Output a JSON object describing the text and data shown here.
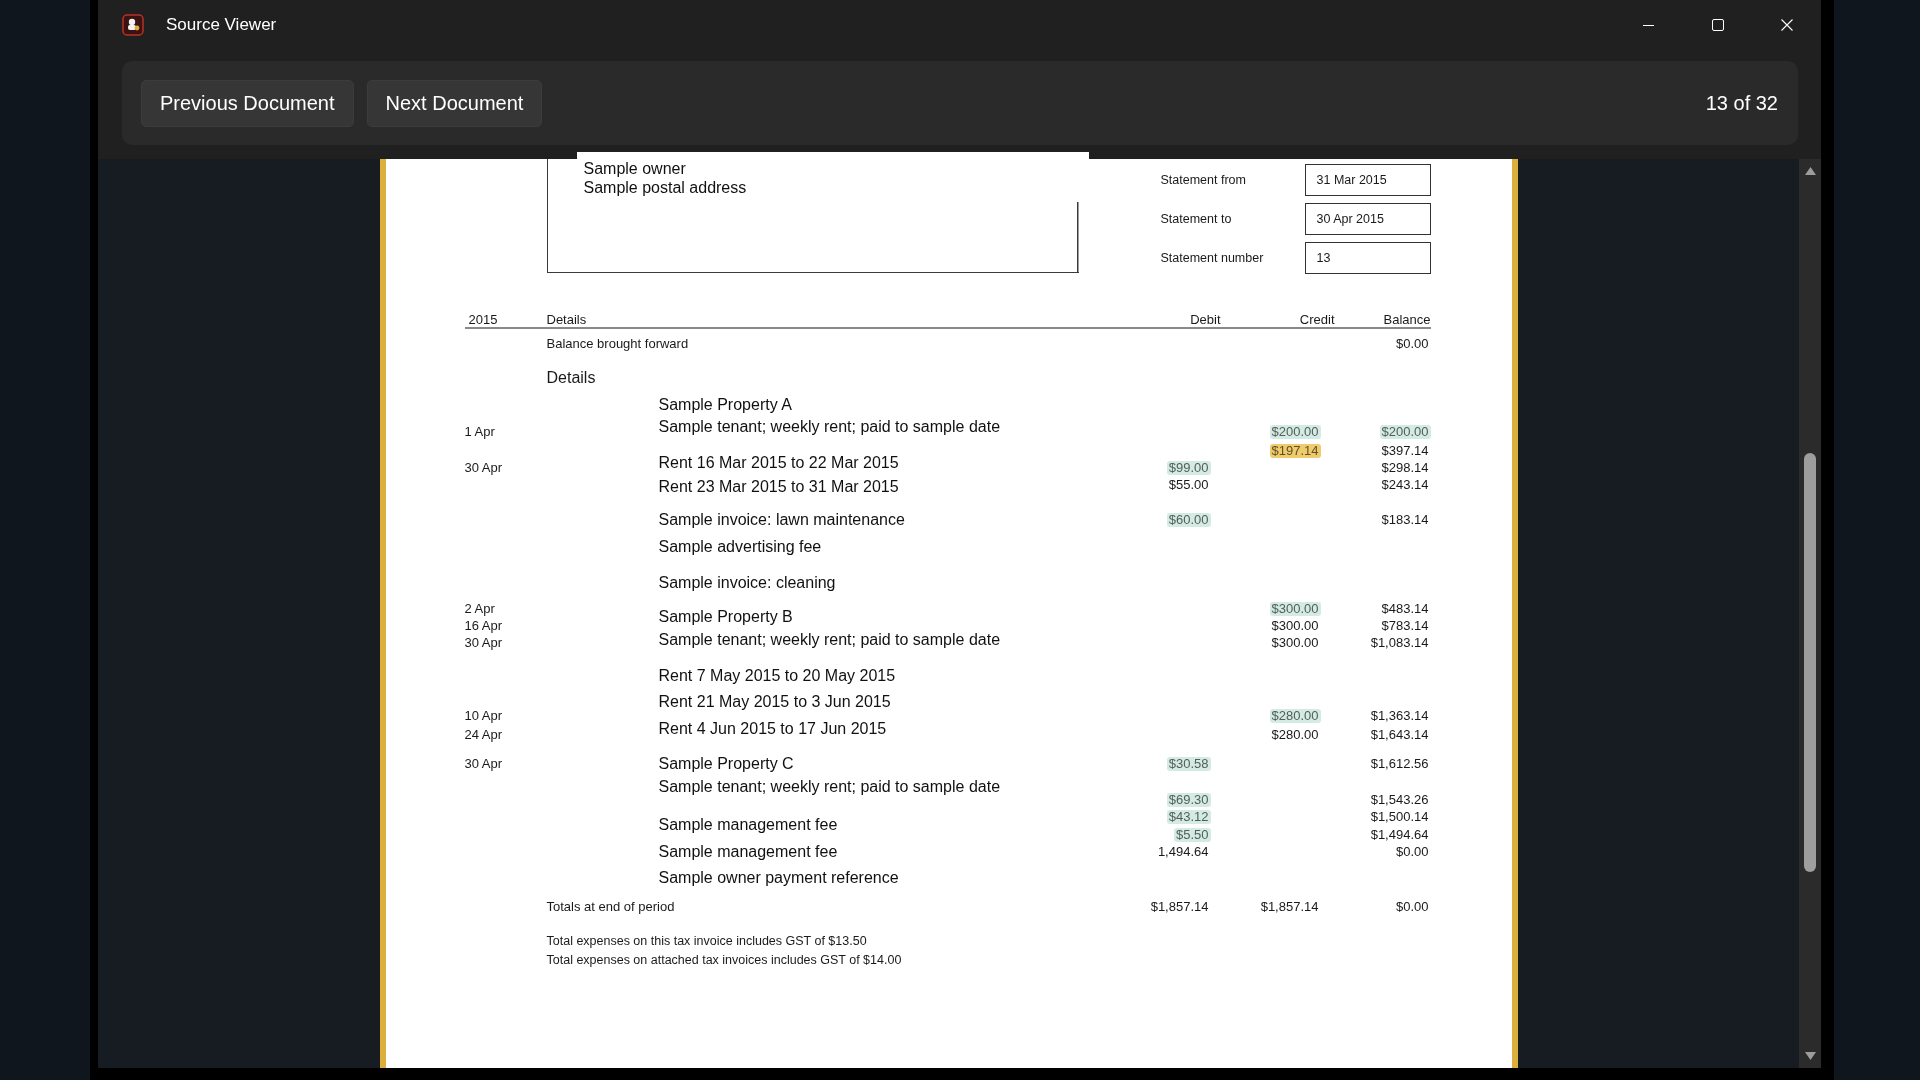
{
  "window": {
    "title": "Source Viewer"
  },
  "toolbar": {
    "buttons": [
      "Previous Document",
      "Next Document"
    ],
    "page_counter": "13 of 32"
  },
  "document": {
    "address_lines": [
      "Sample owner",
      "Sample postal address"
    ],
    "statement_fields": [
      {
        "label": "Statement from",
        "value": "31 Mar 2015"
      },
      {
        "label": "Statement to",
        "value": "30 Apr 2015"
      },
      {
        "label": "Statement number",
        "value": "13"
      }
    ],
    "table": {
      "columns": [
        "2015",
        "Details",
        "Debit",
        "Credit",
        "Balance"
      ],
      "opening_row": {
        "details": "Balance brought forward",
        "balance": "$0.00"
      },
      "section_heading": "Details",
      "descriptions": [
        "Sample Property A",
        "Sample tenant; weekly rent; paid to sample date",
        "Rent 16 Mar 2015 to 22 Mar 2015",
        "Rent 23 Mar 2015 to 31 Mar 2015",
        "Sample invoice: lawn maintenance",
        "Sample advertising fee",
        "Sample invoice: cleaning",
        "Sample Property B",
        "Sample tenant; weekly rent; paid to sample date",
        "Rent 7 May 2015 to 20 May 2015",
        "Rent 21 May 2015 to 3 Jun 2015",
        "Rent 4 Jun 2015 to 17 Jun 2015",
        "Sample Property C",
        "Sample tenant; weekly rent; paid to sample date",
        "Sample management fee",
        "Sample management fee",
        "Sample owner payment reference"
      ],
      "entries": [
        {
          "date": "1 Apr",
          "credit": {
            "text": "$200.00",
            "color": "#d3ebe2"
          },
          "balance": {
            "text": "$200.00",
            "color": "#d3ebe2"
          }
        },
        {
          "credit": {
            "text": "$197.14",
            "color": "#efcb6b"
          },
          "balance": {
            "text": "$397.14"
          }
        },
        {
          "date": "30 Apr",
          "debit": {
            "text": "$99.00",
            "color": "#d3ebe2"
          },
          "balance": {
            "text": "$298.14"
          }
        },
        {
          "debit": {
            "text": "$55.00"
          },
          "balance": {
            "text": "$243.14"
          }
        },
        {
          "debit": {
            "text": "$60.00",
            "color": "#d3ebe2"
          },
          "balance": {
            "text": "$183.14"
          }
        },
        {
          "date": "2 Apr",
          "credit": {
            "text": "$300.00",
            "color": "#d3ebe2"
          },
          "balance": {
            "text": "$483.14"
          }
        },
        {
          "date": "16 Apr",
          "credit": {
            "text": "$300.00"
          },
          "balance": {
            "text": "$783.14"
          }
        },
        {
          "date": "30 Apr",
          "credit": {
            "text": "$300.00"
          },
          "balance": {
            "text": "$1,083.14"
          }
        },
        {
          "date": "10 Apr",
          "credit": {
            "text": "$280.00",
            "color": "#d3ebe2"
          },
          "balance": {
            "text": "$1,363.14"
          }
        },
        {
          "date": "24 Apr",
          "credit": {
            "text": "$280.00"
          },
          "balance": {
            "text": "$1,643.14"
          }
        },
        {
          "date": "30 Apr",
          "debit": {
            "text": "$30.58",
            "color": "#d3ebe2"
          },
          "balance": {
            "text": "$1,612.56"
          }
        },
        {
          "debit": {
            "text": "$69.30",
            "color": "#d3ebe2"
          },
          "balance": {
            "text": "$1,543.26"
          }
        },
        {
          "debit": {
            "text": "$43.12",
            "color": "#d3ebe2"
          },
          "balance": {
            "text": "$1,500.14"
          }
        },
        {
          "debit": {
            "text": "$5.50",
            "color": "#d3ebe2"
          },
          "balance": {
            "text": "$1,494.64"
          }
        },
        {
          "debit": {
            "text": "1,494.64"
          },
          "balance": {
            "text": "$0.00"
          }
        }
      ],
      "totals": {
        "label": "Totals at end of period",
        "debit": "$1,857.14",
        "credit": "$1,857.14",
        "balance": "$0.00"
      }
    },
    "notes": [
      "Total expenses on this tax invoice includes GST of $13.50",
      "Total expenses on attached tax invoices includes GST of $14.00"
    ]
  }
}
